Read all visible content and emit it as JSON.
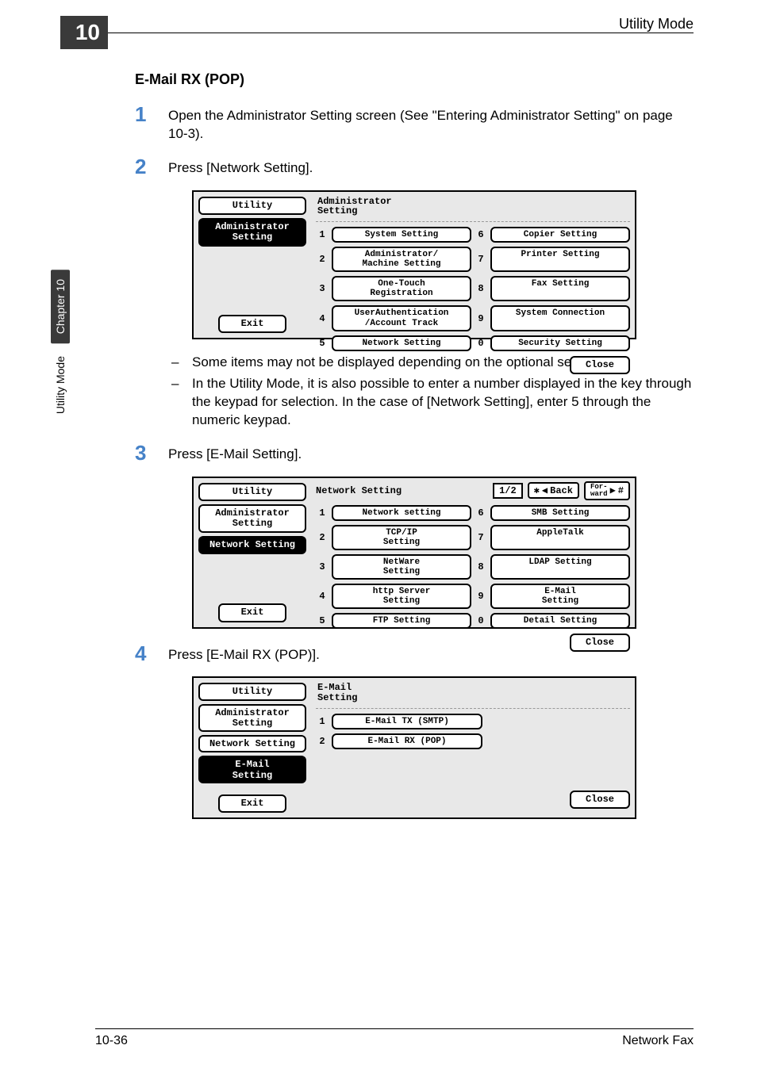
{
  "chapter_tab": "10",
  "header_title": "Utility Mode",
  "side_tab_dark": "Chapter 10",
  "side_tab_light": "Utility Mode",
  "section_heading": "E-Mail RX (POP)",
  "steps": {
    "s1": {
      "num": "1",
      "text": "Open the Administrator Setting screen (See \"Entering Administrator Setting\" on page 10-3)."
    },
    "s2": {
      "num": "2",
      "text": "Press [Network Setting]."
    },
    "s3": {
      "num": "3",
      "text": "Press [E-Mail Setting]."
    },
    "s4": {
      "num": "4",
      "text": "Press [E-Mail RX (POP)]."
    }
  },
  "bullets": {
    "b1": "Some items may not be displayed depending on the optional settings.",
    "b2": "In the Utility Mode, it is also possible to enter a number displayed in the key through the keypad for selection. In the case of [Network Setting], enter 5 through the numeric keypad."
  },
  "panel1": {
    "side_utility": "Utility",
    "side_admin": "Administrator\nSetting",
    "title": "Administrator\nSetting",
    "items": [
      {
        "n": "1",
        "label": "System Setting"
      },
      {
        "n": "2",
        "label": "Administrator/\nMachine Setting"
      },
      {
        "n": "3",
        "label": "One-Touch\nRegistration"
      },
      {
        "n": "4",
        "label": "UserAuthentication\n/Account Track"
      },
      {
        "n": "5",
        "label": "Network Setting"
      },
      {
        "n": "6",
        "label": "Copier Setting"
      },
      {
        "n": "7",
        "label": "Printer Setting"
      },
      {
        "n": "8",
        "label": "Fax Setting"
      },
      {
        "n": "9",
        "label": "System Connection"
      },
      {
        "n": "0",
        "label": "Security Setting"
      }
    ],
    "exit": "Exit",
    "close": "Close"
  },
  "panel2": {
    "side_utility": "Utility",
    "side_admin": "Administrator\nSetting",
    "side_net": "Network Setting",
    "title": "Network Setting",
    "page": "1/2",
    "back": "Back",
    "forward": "For-\nward",
    "items": [
      {
        "n": "1",
        "label": "Network setting"
      },
      {
        "n": "2",
        "label": "TCP/IP\nSetting"
      },
      {
        "n": "3",
        "label": "NetWare\nSetting"
      },
      {
        "n": "4",
        "label": "http Server\nSetting"
      },
      {
        "n": "5",
        "label": "FTP Setting"
      },
      {
        "n": "6",
        "label": "SMB Setting"
      },
      {
        "n": "7",
        "label": "AppleTalk"
      },
      {
        "n": "8",
        "label": "LDAP Setting"
      },
      {
        "n": "9",
        "label": "E-Mail\nSetting"
      },
      {
        "n": "0",
        "label": "Detail Setting"
      }
    ],
    "exit": "Exit",
    "close": "Close"
  },
  "panel3": {
    "side_utility": "Utility",
    "side_admin": "Administrator\nSetting",
    "side_net": "Network Setting",
    "side_email": "E-Mail\nSetting",
    "title": "E-Mail\nSetting",
    "items": [
      {
        "n": "1",
        "label": "E-Mail TX (SMTP)"
      },
      {
        "n": "2",
        "label": "E-Mail RX (POP)"
      }
    ],
    "exit": "Exit",
    "close": "Close"
  },
  "footer": {
    "left": "10-36",
    "right": "Network Fax"
  }
}
